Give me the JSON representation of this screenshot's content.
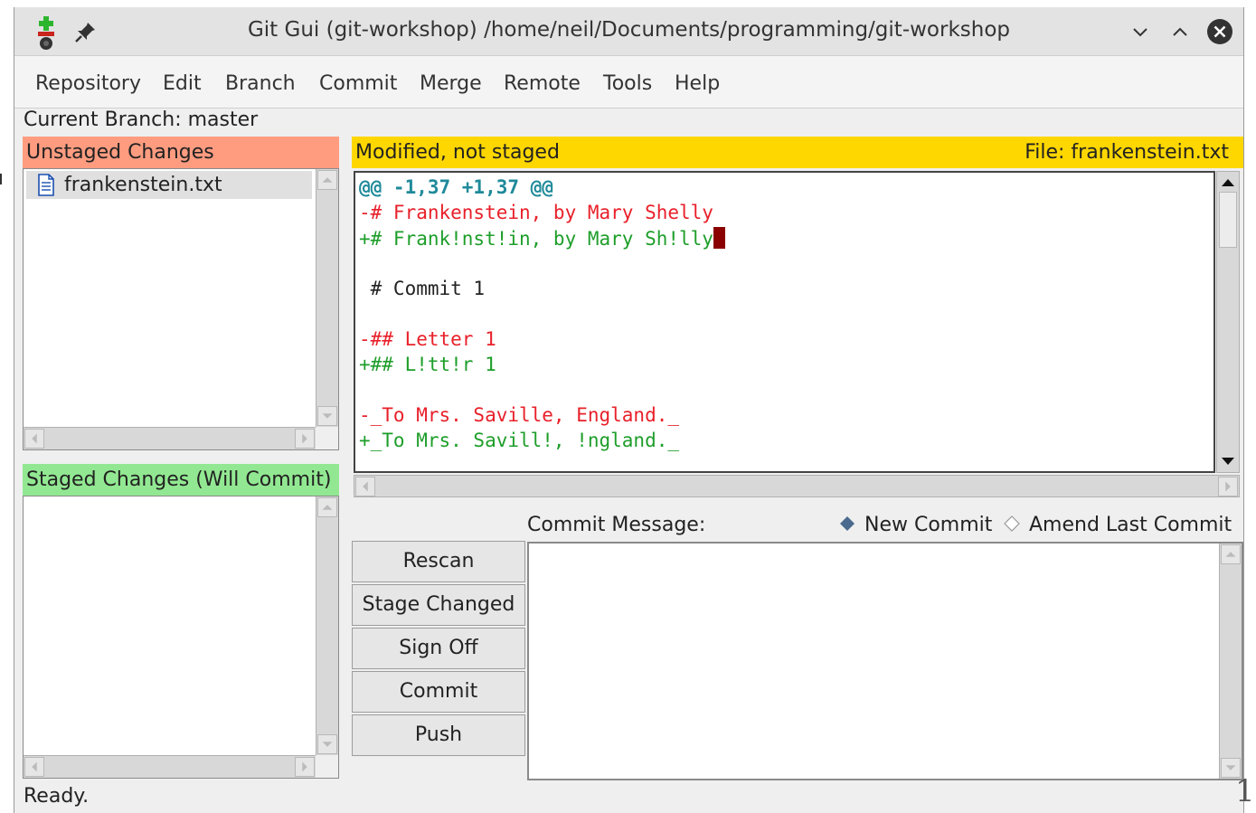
{
  "window": {
    "title": "Git Gui (git-workshop) /home/neil/Documents/programming/git-workshop"
  },
  "menu": [
    "Repository",
    "Edit",
    "Branch",
    "Commit",
    "Merge",
    "Remote",
    "Tools",
    "Help"
  ],
  "current_branch": "Current Branch: master",
  "unstaged": {
    "header": "Unstaged Changes",
    "files": [
      "frankenstein.txt"
    ]
  },
  "staged": {
    "header": "Staged Changes (Will Commit)",
    "files": []
  },
  "diff": {
    "status": "Modified, not staged",
    "file": "File: frankenstein.txt",
    "lines": [
      {
        "type": "hunk",
        "text": "@@ -1,37 +1,37 @@"
      },
      {
        "type": "del",
        "text": "-# Frankenstein, by Mary Shelly"
      },
      {
        "type": "add",
        "text": "+# Frank!nst!in, by Mary Sh!lly"
      },
      {
        "type": "ctx",
        "text": " "
      },
      {
        "type": "ctx",
        "text": " # Commit 1"
      },
      {
        "type": "ctx",
        "text": " "
      },
      {
        "type": "del",
        "text": "-## Letter 1"
      },
      {
        "type": "add",
        "text": "+## L!tt!r 1"
      },
      {
        "type": "ctx",
        "text": " "
      },
      {
        "type": "del",
        "text": "-_To Mrs. Saville, England._"
      },
      {
        "type": "add",
        "text": "+_To Mrs. Savill!, !ngland._"
      }
    ]
  },
  "commit": {
    "message_label": "Commit Message:",
    "new_commit": "New Commit",
    "amend": "Amend Last Commit",
    "selected": "new",
    "message": ""
  },
  "buttons": {
    "rescan": "Rescan",
    "stage_changed": "Stage Changed",
    "sign_off": "Sign Off",
    "commit": "Commit",
    "push": "Push"
  },
  "status": "Ready.",
  "corner_glyph": "1",
  "colors": {
    "unstaged_header": "#ff9c80",
    "staged_header": "#92e892",
    "diff_header": "#ffd700",
    "hunk": "#1f8a9a",
    "deleted": "#e8202a",
    "added": "#1e9e2a",
    "cursor": "#8b0000"
  },
  "icons": [
    "git-gui-app-icon",
    "pin-icon",
    "minimize-icon",
    "maximize-icon",
    "close-icon",
    "text-file-icon"
  ]
}
